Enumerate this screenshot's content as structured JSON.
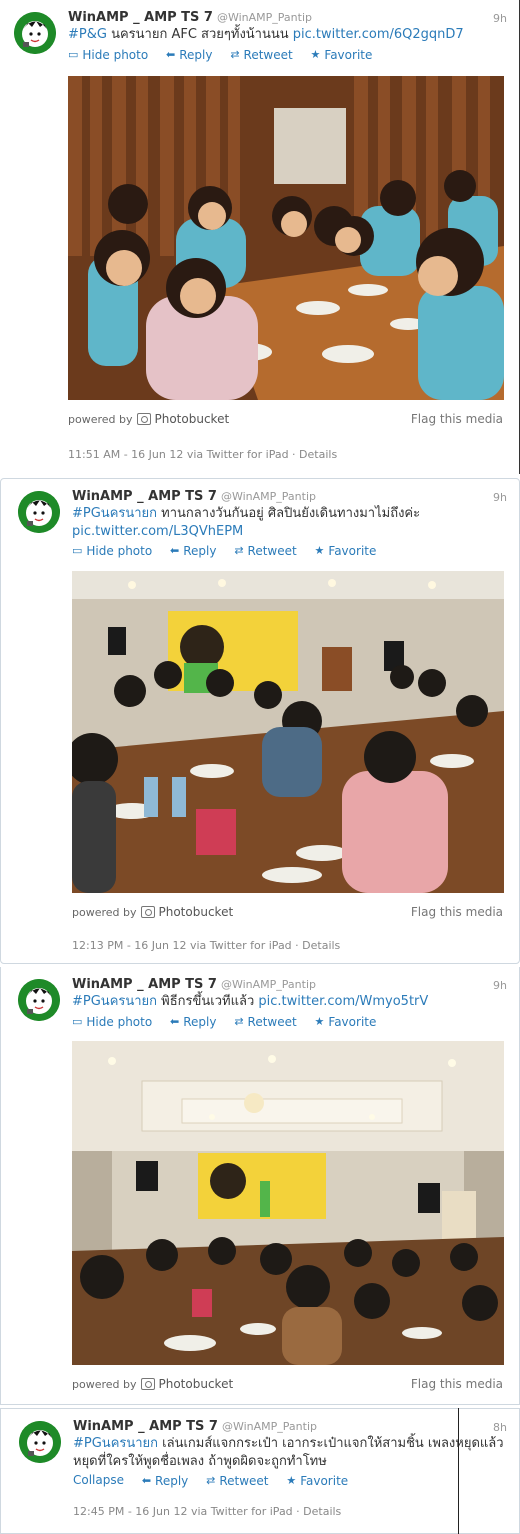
{
  "tweets": [
    {
      "author": "WinAMP _ AMP TS 7",
      "handle": "@WinAMP_Pantip",
      "age": "9h",
      "hashtag": "#P&G",
      "text": " นครนายก AFC สวยๆทั้งน้านนน ",
      "link": "pic.twitter.com/6Q2gqnD7",
      "actions": {
        "media": "Hide photo",
        "reply": "Reply",
        "retweet": "Retweet",
        "favorite": "Favorite"
      },
      "powered": "powered by",
      "provider": "Photobucket",
      "flag": "Flag this media",
      "meta": "11:51 AM - 16 Jun 12 via Twitter for iPad · Details"
    },
    {
      "author": "WinAMP _ AMP TS 7",
      "handle": "@WinAMP_Pantip",
      "age": "9h",
      "hashtag": "#PGนครนายก",
      "text": " ทานกลางวันกันอยู่ ศิลปินยังเดินทางมาไม่ถึงค่ะ",
      "link": "pic.twitter.com/L3QVhEPM",
      "actions": {
        "media": "Hide photo",
        "reply": "Reply",
        "retweet": "Retweet",
        "favorite": "Favorite"
      },
      "powered": "powered by",
      "provider": "Photobucket",
      "flag": "Flag this media",
      "meta": "12:13 PM - 16 Jun 12 via Twitter for iPad · Details"
    },
    {
      "author": "WinAMP _ AMP TS 7",
      "handle": "@WinAMP_Pantip",
      "age": "9h",
      "hashtag": "#PGนครนายก",
      "text": " พิธีกรขึ้นเวทีแล้ว ",
      "link": "pic.twitter.com/Wmyo5trV",
      "actions": {
        "media": "Hide photo",
        "reply": "Reply",
        "retweet": "Retweet",
        "favorite": "Favorite"
      },
      "powered": "powered by",
      "provider": "Photobucket",
      "flag": "Flag this media"
    },
    {
      "author": "WinAMP _ AMP TS 7",
      "handle": "@WinAMP_Pantip",
      "age": "8h",
      "hashtag": "#PGนครนายก",
      "text": " เล่นเกมส์แจกกระเป๋า เอากระเป๋าแจกให้สามชิ้น เพลงหยุดแล้วหยุดที่ใครให้พูดชื่อเพลง ถ้าพูดผิดจะถูกทำโทษ",
      "actions": {
        "media": "Collapse",
        "reply": "Reply",
        "retweet": "Retweet",
        "favorite": "Favorite"
      },
      "meta": "12:45 PM - 16 Jun 12 via Twitter for iPad · Details"
    }
  ],
  "colors": {
    "link": "#2b7bb9",
    "avatar_bg": "#1e8a28",
    "banner": "#f3d23a"
  },
  "icons": {
    "media": "photo-icon",
    "reply": "reply-icon",
    "retweet": "retweet-icon",
    "favorite": "star-icon"
  }
}
